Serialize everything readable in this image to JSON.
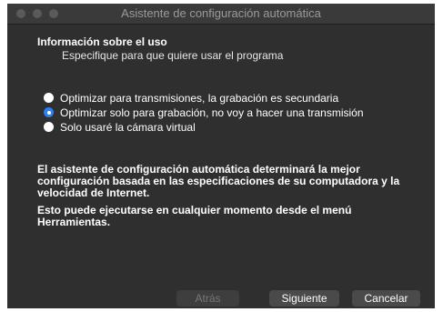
{
  "window": {
    "title": "Asistente de configuración automática"
  },
  "usage": {
    "heading": "Información sobre el uso",
    "subheading": "Especifique para que quiere usar el programa",
    "options": [
      {
        "label": "Optimizar para transmisiones, la grabación es secundaria",
        "selected": false
      },
      {
        "label": "Optimizar solo para grabación, no voy a hacer una transmisión",
        "selected": true
      },
      {
        "label": "Solo usaré la cámara virtual",
        "selected": false
      }
    ]
  },
  "info": {
    "paragraph1": "El asistente de configuración automática determinará la mejor configuración basada en las especificaciones de su computadora y la velocidad de Internet.",
    "paragraph2": "Esto puede ejecutarse en cualquier momento desde el menú Herramientas."
  },
  "buttons": {
    "back": "Atrás",
    "next": "Siguiente",
    "cancel": "Cancelar"
  },
  "colors": {
    "accent": "#2f7ff0",
    "background": "#2f2f2f"
  }
}
